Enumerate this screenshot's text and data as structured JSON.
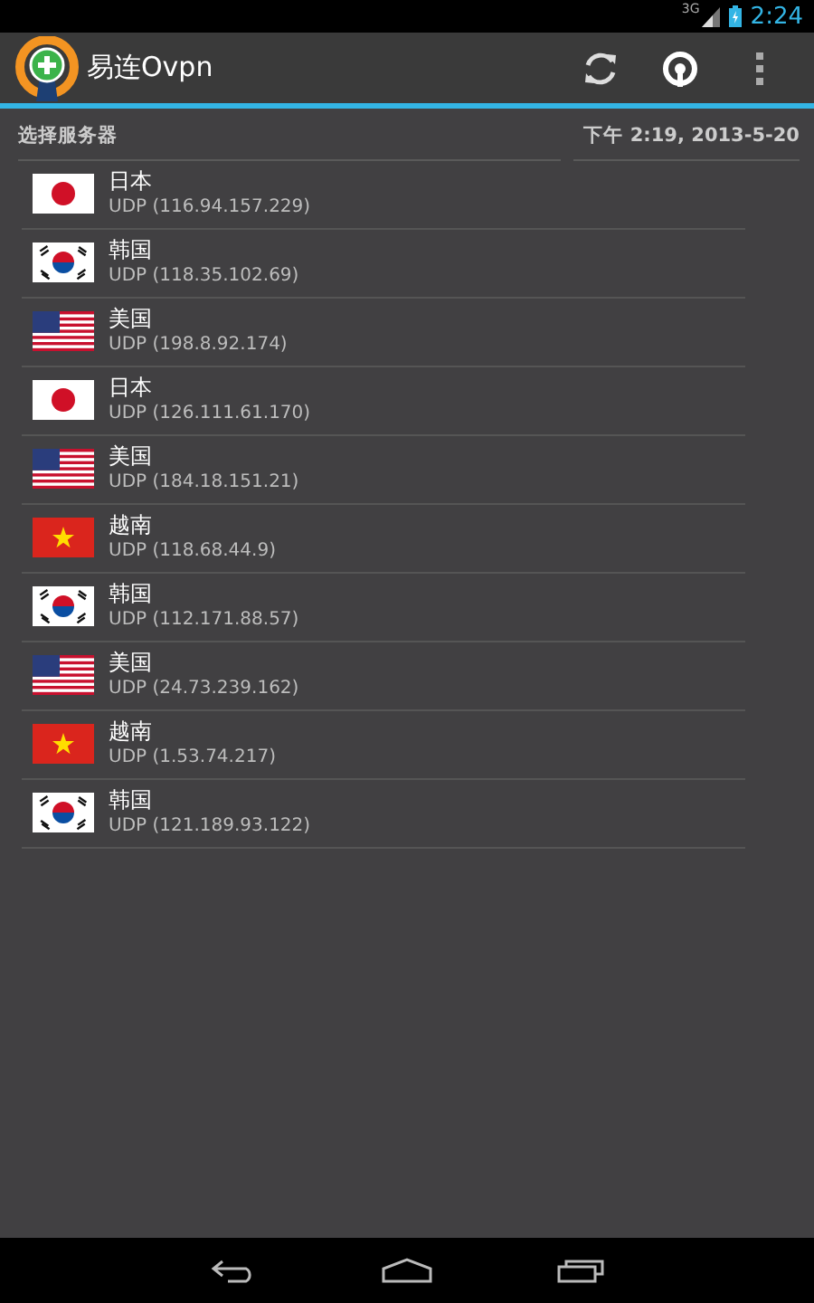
{
  "status_bar": {
    "network": "3G",
    "time": "2:24"
  },
  "action_bar": {
    "title": "易连Ovpn"
  },
  "header": {
    "label": "选择服务器",
    "timestamp": "下午 2:19, 2013-5-20"
  },
  "servers": [
    {
      "kind": "japan",
      "name": "日本",
      "address": "UDP (116.94.157.229)"
    },
    {
      "kind": "korea",
      "name": "韩国",
      "address": "UDP (118.35.102.69)"
    },
    {
      "kind": "usa",
      "name": "美国",
      "address": "UDP (198.8.92.174)"
    },
    {
      "kind": "japan",
      "name": "日本",
      "address": "UDP (126.111.61.170)"
    },
    {
      "kind": "usa",
      "name": "美国",
      "address": "UDP (184.18.151.21)"
    },
    {
      "kind": "vietnam",
      "name": "越南",
      "address": "UDP (118.68.44.9)"
    },
    {
      "kind": "korea",
      "name": "韩国",
      "address": "UDP (112.171.88.57)"
    },
    {
      "kind": "usa",
      "name": "美国",
      "address": "UDP (24.73.239.162)"
    },
    {
      "kind": "vietnam",
      "name": "越南",
      "address": "UDP (1.53.74.217)"
    },
    {
      "kind": "korea",
      "name": "韩国",
      "address": "UDP (121.189.93.122)"
    }
  ]
}
